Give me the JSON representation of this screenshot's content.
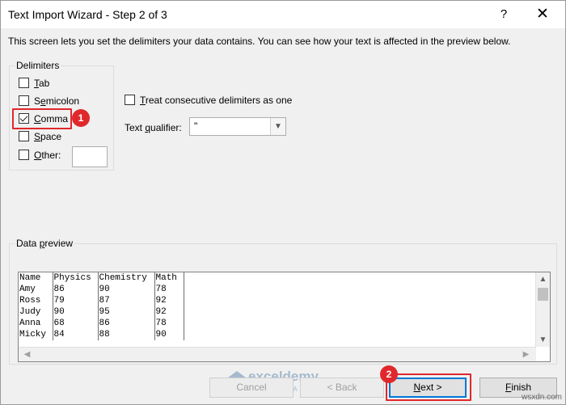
{
  "window": {
    "title": "Text Import Wizard - Step 2 of 3",
    "help_glyph": "?",
    "close_glyph": "✕"
  },
  "instructions": "This screen lets you set the delimiters your data contains.  You can see how your text is affected in the preview below.",
  "delimiters": {
    "label": "Delimiters",
    "tab": {
      "label": "Tab",
      "checked": false
    },
    "semicolon": {
      "label": "Semicolon",
      "checked": false
    },
    "comma": {
      "label": "Comma",
      "checked": true
    },
    "space": {
      "label": "Space",
      "checked": false
    },
    "other": {
      "label": "Other:",
      "checked": false,
      "value": ""
    }
  },
  "consecutive": {
    "label": "Treat consecutive delimiters as one",
    "checked": false
  },
  "qualifier": {
    "label": "Text qualifier:",
    "value": "\""
  },
  "preview": {
    "label": "Data preview",
    "rows": [
      [
        "Name",
        "Physics",
        "Chemistry",
        "Math"
      ],
      [
        "Amy",
        "86",
        "90",
        "78"
      ],
      [
        "Ross",
        "79",
        "87",
        "92"
      ],
      [
        "Judy",
        "90",
        "95",
        "92"
      ],
      [
        "Anna",
        "68",
        "86",
        "78"
      ],
      [
        "Micky",
        "84",
        "88",
        "90"
      ]
    ]
  },
  "buttons": {
    "cancel": "Cancel",
    "back": "< Back",
    "next": "Next >",
    "finish": "Finish"
  },
  "annotations": {
    "step1": "1",
    "step2": "2",
    "highlight_color": "#e0282c"
  },
  "watermark": {
    "title": "exceldemy",
    "subtitle": "EXCEL · DATA · BI"
  },
  "site_mark": "wsxdn.com"
}
